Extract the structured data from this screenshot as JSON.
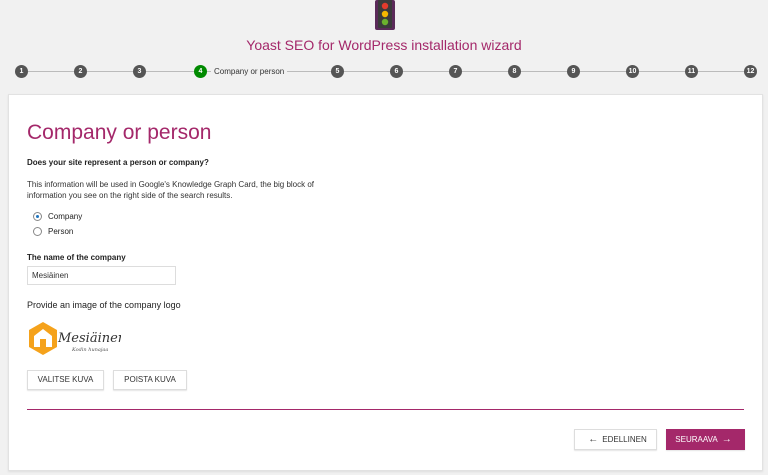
{
  "header": {
    "title": "Yoast SEO for WordPress installation wizard"
  },
  "stepper": {
    "steps": [
      "1",
      "2",
      "3",
      "4",
      "5",
      "6",
      "7",
      "8",
      "9",
      "10",
      "11",
      "12"
    ],
    "active_label": "Company or person"
  },
  "page": {
    "heading": "Company or person",
    "question": "Does your site represent a person or company?",
    "description": "This information will be used in Google's Knowledge Graph Card, the big block of information you see on the right side of the search results.",
    "options": [
      {
        "label": "Company",
        "checked": true
      },
      {
        "label": "Person",
        "checked": false
      }
    ],
    "company_name_label": "The name of the company",
    "company_name_value": "Mesiäinen",
    "logo_label": "Provide an image of the company logo",
    "logo_text": "Mesiäinen",
    "logo_subtext": "Kodin hunajaa",
    "select_image_button": "VALITSE KUVA",
    "remove_image_button": "POISTA KUVA"
  },
  "nav": {
    "prev_label": "EDELLINEN",
    "next_label": "SEURAAVA"
  },
  "colors": {
    "accent": "#a4286a",
    "active_step": "#008a00"
  }
}
